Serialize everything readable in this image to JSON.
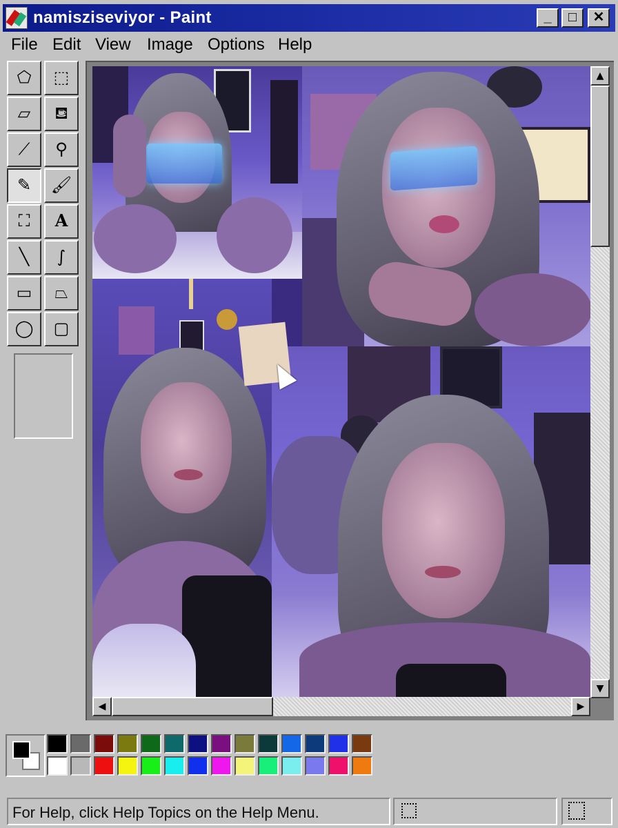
{
  "window": {
    "title": "namisziseviyor - Paint"
  },
  "title_buttons": {
    "minimize": "_",
    "maximize": "□",
    "close": "✕"
  },
  "menu": [
    {
      "label": "File"
    },
    {
      "label": "Edit"
    },
    {
      "label": "View"
    },
    {
      "label": "Image"
    },
    {
      "label": "Options"
    },
    {
      "label": "Help"
    }
  ],
  "tools": [
    {
      "name": "free-select",
      "glyph": "⬠"
    },
    {
      "name": "select",
      "glyph": "⬚"
    },
    {
      "name": "eraser",
      "glyph": "▱"
    },
    {
      "name": "fill-bucket",
      "glyph": "⛾"
    },
    {
      "name": "color-picker",
      "glyph": "⟋"
    },
    {
      "name": "magnifier",
      "glyph": "⚲"
    },
    {
      "name": "pencil",
      "glyph": "✎"
    },
    {
      "name": "brush",
      "glyph": "🖌"
    },
    {
      "name": "airbrush",
      "glyph": "⛶"
    },
    {
      "name": "text",
      "glyph": "A"
    },
    {
      "name": "line",
      "glyph": "╲"
    },
    {
      "name": "curve",
      "glyph": "∫"
    },
    {
      "name": "rectangle",
      "glyph": "▭"
    },
    {
      "name": "polygon",
      "glyph": "⏢"
    },
    {
      "name": "ellipse",
      "glyph": "◯"
    },
    {
      "name": "rounded-rectangle",
      "glyph": "▢"
    }
  ],
  "active_tool": "pencil",
  "palette": {
    "foreground": "#000000",
    "background": "#ffffff",
    "row1": [
      "#000000",
      "#6a6a6a",
      "#7a0c0c",
      "#7a7a10",
      "#0e6a18",
      "#0e6a6a",
      "#0c1080",
      "#7a1080",
      "#7a7a3a",
      "#0c3a3a",
      "#1468e8",
      "#0c3a7a",
      "#2030e8",
      "#7a3a10"
    ],
    "row2": [
      "#ffffff",
      "#b8b8b8",
      "#ee1010",
      "#f4f410",
      "#18ee18",
      "#18eeee",
      "#1030ee",
      "#ee18ee",
      "#f4f47a",
      "#18ee7a",
      "#7aeeee",
      "#7a7aee",
      "#ee106a",
      "#ee7a10"
    ]
  },
  "status": {
    "help_text": "For Help, click Help Topics on the Help Menu."
  }
}
